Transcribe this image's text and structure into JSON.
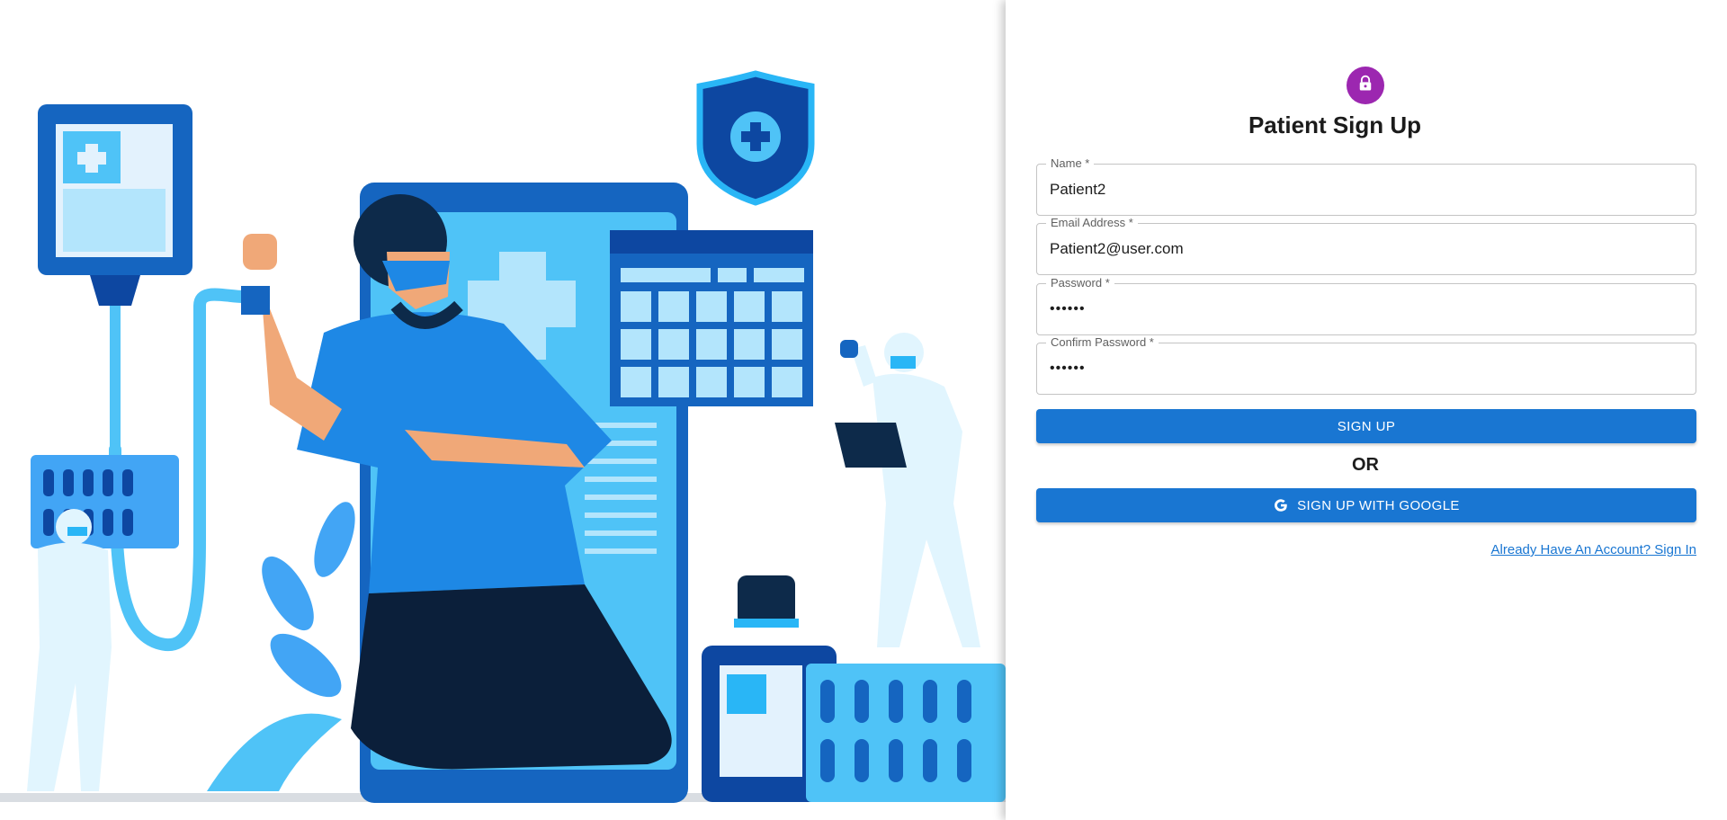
{
  "form": {
    "title": "Patient Sign Up",
    "fields": [
      {
        "label": "Name *",
        "value": "Patient2"
      },
      {
        "label": "Email Address *",
        "value": "Patient2@user.com"
      },
      {
        "label": "Password *",
        "value": "••••••"
      },
      {
        "label": "Confirm Password *",
        "value": "••••••"
      }
    ],
    "signup_label": "SIGN UP",
    "or_label": "OR",
    "google_label": "SIGN UP WITH GOOGLE",
    "signin_link": "Already Have An Account? Sign In"
  },
  "colors": {
    "avatar": "#9c27b0",
    "primary_button": "#1976d2",
    "link": "#1976d2"
  },
  "icons": [
    "lock-icon",
    "google-icon"
  ]
}
